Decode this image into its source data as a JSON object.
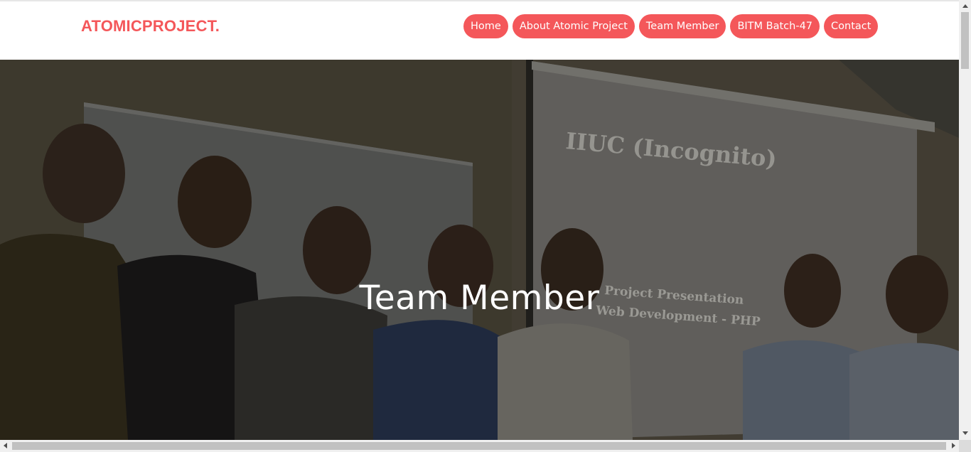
{
  "header": {
    "logo": "ATOMICPROJECT.",
    "nav": [
      {
        "label": "Home"
      },
      {
        "label": "About Atomic Project"
      },
      {
        "label": "Team Member"
      },
      {
        "label": "BITM Batch-47"
      },
      {
        "label": "Contact"
      }
    ]
  },
  "hero": {
    "title": "Team Member",
    "slide_line1": "IIUC (Incognito)",
    "slide_line2": "Project Presentation",
    "slide_line3": "Web Development - PHP"
  },
  "colors": {
    "accent": "#f4575a",
    "header_bg": "#ffffff",
    "hero_text": "#ffffff"
  }
}
